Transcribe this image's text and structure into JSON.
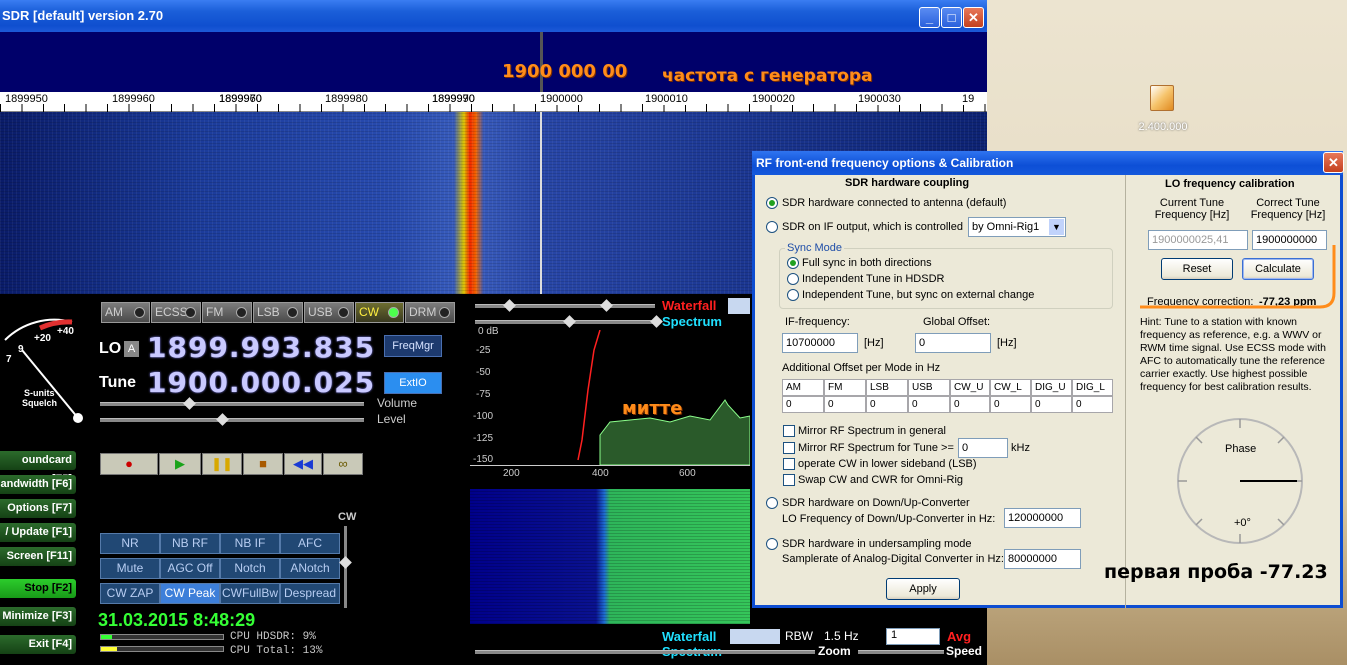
{
  "app": {
    "title": "SDR [default]  version 2.70",
    "title_buttons": {
      "minimize": "_",
      "maximize": "□",
      "close": "✕"
    }
  },
  "annotations": {
    "center_freq": "1900 000 00",
    "generator_note": "частота с генератора",
    "signal_note": "митте",
    "first_probe": "первая проба -77.23"
  },
  "freq_scale": [
    "1899950",
    "1899960",
    "1899970",
    "1899980",
    "1899990",
    "1900000",
    "1900010",
    "1900020",
    "1900030",
    "19"
  ],
  "modes": [
    "AM",
    "ECSS",
    "FM",
    "LSB",
    "USB",
    "CW",
    "DRM"
  ],
  "active_mode": "CW",
  "lo": {
    "label": "LO",
    "sub": "A",
    "value": "1899.993.835"
  },
  "tune": {
    "label": "Tune",
    "value": "1900.000.025"
  },
  "freqmgr": "FreqMgr",
  "extio": "ExtIO",
  "volume_label": "Volume",
  "level_label": "Level",
  "smeter": {
    "scale_20": "+20",
    "scale_40": "+40",
    "scale_9": "9",
    "scale_7": "7",
    "label1": "S-units",
    "label2": "Squelch"
  },
  "side_buttons": [
    {
      "label": "oundcard  [F5]"
    },
    {
      "label": "andwidth  [F6]"
    },
    {
      "label": "Options  [F7]"
    },
    {
      "label": "/ Update  [F1]"
    },
    {
      "label": "Screen  [F11]"
    },
    {
      "label": "Stop    [F2]"
    },
    {
      "label": "Minimize  [F3]"
    },
    {
      "label": "Exit    [F4]"
    }
  ],
  "transport": {
    "record": "●",
    "play": "▶",
    "pause": "❚❚",
    "stop": "■",
    "rewind": "◀◀",
    "loop": "∞"
  },
  "dsp_buttons": [
    "NR",
    "NB RF",
    "NB IF",
    "AFC",
    "Mute",
    "AGC Off",
    "Notch",
    "ANotch",
    "CW ZAP",
    "CW Peak",
    "CWFullBw",
    "Despread"
  ],
  "cw_label": "CW",
  "datetime": "31.03.2015 8:48:29",
  "cpu": {
    "hdsdr": "CPU HDSDR:  9%",
    "total": "CPU Total: 13%",
    "hdsdr_pct": 9,
    "total_pct": 13
  },
  "spectrum_panel": {
    "waterfall_label": "Waterfall",
    "spectrum_label": "Spectrum",
    "db_labels": [
      "0 dB",
      "-25",
      "-50",
      "-75",
      "-100",
      "-125",
      "-150"
    ],
    "axis_labels": [
      "200",
      "400",
      "600"
    ]
  },
  "bottom_bar": {
    "waterfall": "Waterfall",
    "spectrum": "Spectrum",
    "rbw_label": "RBW",
    "rbw_value": "1.5 Hz",
    "avg_select": "1",
    "avg_label": "Avg",
    "zoom_label": "Zoom",
    "speed_label": "Speed"
  },
  "desktop_icon": {
    "label": "2.400.000"
  },
  "dialog": {
    "title": "RF front-end frequency options & Calibration",
    "close": "✕",
    "left_header": "SDR hardware coupling",
    "opt_antenna": "SDR hardware connected to antenna (default)",
    "opt_if": "SDR on IF output, which is controlled",
    "if_select": "by Omni-Rig1",
    "sync_mode_label": "Sync Mode",
    "sync_full": "Full sync in both directions",
    "sync_indep": "Independent Tune in HDSDR",
    "sync_indep_ext": "Independent Tune, but sync on external change",
    "if_freq_label": "IF-frequency:",
    "if_freq_value": "10700000",
    "if_freq_unit": "[Hz]",
    "global_offset_label": "Global Offset:",
    "global_offset_value": "0",
    "global_offset_unit": "[Hz]",
    "add_offset_label": "Additional Offset per Mode in Hz",
    "offset_heads": [
      "AM",
      "FM",
      "LSB",
      "USB",
      "CW_U",
      "CW_L",
      "DIG_U",
      "DIG_L"
    ],
    "offset_values": [
      "0",
      "0",
      "0",
      "0",
      "0",
      "0",
      "0",
      "0"
    ],
    "mirror_rf": "Mirror RF Spectrum in general",
    "mirror_tune": "Mirror RF Spectrum for Tune >=",
    "mirror_tune_value": "0",
    "mirror_tune_unit": "kHz",
    "cw_lsb": "operate CW in lower sideband (LSB)",
    "swap_cw": "Swap CW and CWR for Omni-Rig",
    "opt_converter": "SDR hardware on Down/Up-Converter",
    "lo_conv_label": "LO Frequency of  Down/Up-Converter in Hz:",
    "lo_conv_value": "120000000",
    "opt_undersampling": "SDR hardware in undersampling mode",
    "samplerate_label": "Samplerate of Analog-Digital Converter in Hz:",
    "samplerate_value": "80000000",
    "apply": "Apply",
    "right_header": "LO frequency calibration",
    "current_tune_label": "Current Tune Frequency [Hz]",
    "correct_tune_label": "Correct Tune Frequency [Hz]",
    "current_tune_value": "1900000025,41",
    "correct_tune_value": "1900000000",
    "reset": "Reset",
    "calculate": "Calculate",
    "freq_corr_label": "Frequency correction:",
    "freq_corr_value": "-77,23 ppm",
    "hint": "Hint: Tune to a station with known frequency as reference, e.g. a WWV or RWM time signal. Use ECSS mode with AFC to automatically tune the reference carrier exactly. Use highest possible frequency for best calibration results.",
    "phase_label": "Phase",
    "phase_zero": "+0°"
  },
  "colors": {
    "accent_orange": "#ff8c1a",
    "lcd": "#c9c9ff",
    "xp_blue": "#0d4fd6"
  }
}
